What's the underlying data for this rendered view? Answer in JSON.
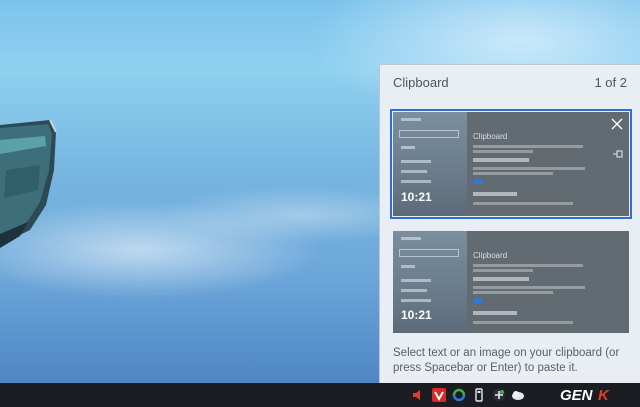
{
  "desktop": {
    "wallpaper": "lake-with-boat"
  },
  "clipboard": {
    "title": "Clipboard",
    "count": "1 of 2",
    "hint": "Select text or an image on your clipboard (or press Spacebar or Enter) to paste it.",
    "items": [
      {
        "time": "10:21",
        "heading": "Clipboard",
        "selected": true
      },
      {
        "time": "10:21",
        "heading": "Clipboard",
        "selected": false
      }
    ]
  },
  "taskbar": {
    "tray_icons": [
      "volume-icon",
      "vivaldi-icon",
      "sync-icon",
      "usb-drive-icon",
      "network-icon",
      "weather-icon"
    ],
    "brand": "GENK"
  },
  "colors": {
    "accent": "#2f6fd0",
    "panel_bg": "#e9eef4",
    "taskbar_bg": "#1b1d22",
    "brand_accent": "#e8392a"
  }
}
